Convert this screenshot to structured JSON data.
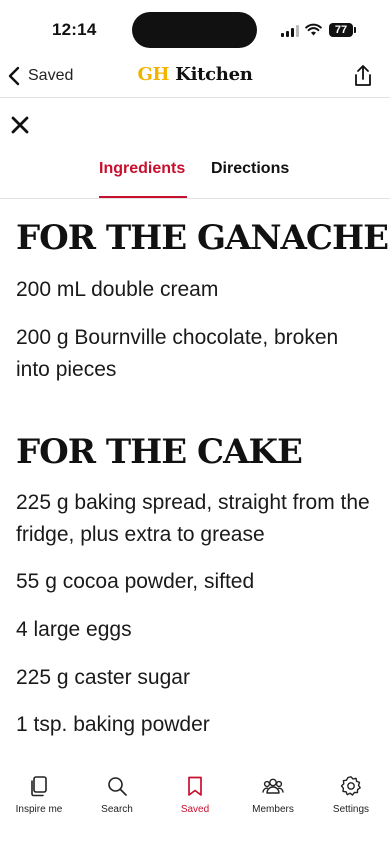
{
  "status_bar": {
    "time": "12:14",
    "battery": "77"
  },
  "header": {
    "back_label": "Saved",
    "brand_part1": "GH",
    "brand_part2": " Kitchen"
  },
  "tabs": [
    {
      "label": "Ingredients",
      "active": true
    },
    {
      "label": "Directions",
      "active": false
    }
  ],
  "sections": [
    {
      "heading": "FOR THE GANACHE",
      "items": [
        "200 mL double cream",
        "200 g Bournville chocolate, broken into pieces"
      ]
    },
    {
      "heading": "FOR THE CAKE",
      "items": [
        "225 g baking spread, straight from the fridge, plus extra to grease",
        "55 g cocoa powder, sifted",
        "4 large eggs",
        "225 g caster sugar",
        "1 tsp. baking powder"
      ]
    }
  ],
  "bottom_nav": [
    {
      "label": "Inspire me",
      "icon": "cards-icon"
    },
    {
      "label": "Search",
      "icon": "search-icon"
    },
    {
      "label": "Saved",
      "icon": "bookmark-icon",
      "active": true
    },
    {
      "label": "Members",
      "icon": "members-icon"
    },
    {
      "label": "Settings",
      "icon": "gear-icon"
    }
  ],
  "colors": {
    "accent": "#c8102e",
    "brand_gold": "#f2b400"
  }
}
